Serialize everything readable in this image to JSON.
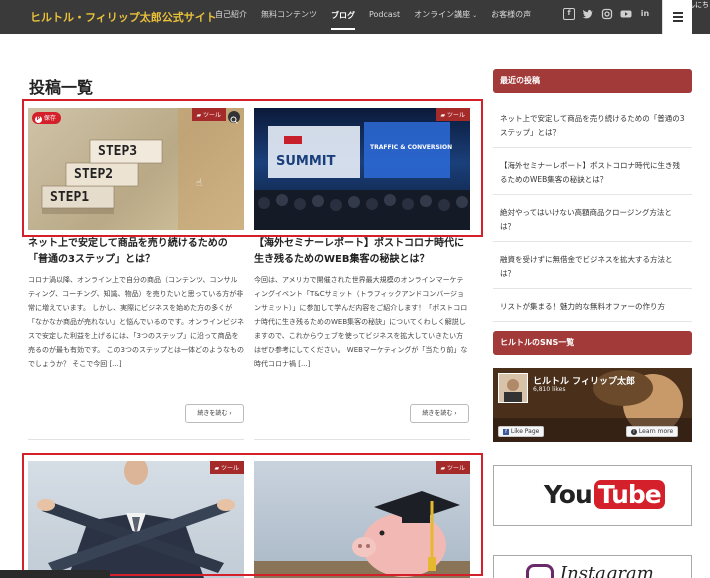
{
  "header": {
    "site_title": "ヒルトル・フィリップ太郎公式サイト",
    "nav": [
      {
        "label": "自己紹介"
      },
      {
        "label": "無料コンテンツ"
      },
      {
        "label": "ブログ"
      },
      {
        "label": "Podcast"
      },
      {
        "label": "オンライン講座"
      },
      {
        "label": "お客様の声"
      }
    ],
    "caret": "⌄",
    "social_icons": [
      "facebook-icon",
      "twitter-icon",
      "instagram-icon",
      "youtube-icon",
      "linkedin-icon"
    ],
    "menu_tip": "んにち"
  },
  "main": {
    "page_title": "投稿一覧",
    "posts": [
      {
        "category": "ツール",
        "save_label": "保存",
        "image_text": [
          "STEP3",
          "STEP2",
          "STEP1"
        ],
        "title": "ネット上で安定して商品を売り続けるための「普通の3ステップ」とは？",
        "excerpt": "コロナ渦以降、オンライン上で自分の商品（コンテンツ、コンサルティング、コーチング、知識、物品）を売りたいと思っている方が非常に増えています。 しかし、実際にビジネスを始めた方の多くが「なかなか商品が売れない」と悩んでいるのです。オンラインビジネスで安定した利益を上げるには、「3つのステップ」に沿って商品を売るのが最も有効です。 この3つのステップとは一体どのようなものでしょうか？ そこで今回 [...]",
        "more_label": "続きを読む"
      },
      {
        "category": "ツール",
        "image_text": [
          "SUMMIT",
          "TRAFFIC & CONVERSION"
        ],
        "title": "【海外セミナーレポート】ポストコロナ時代に生き残るためのWEB集客の秘訣とは？",
        "excerpt": "今回は、アメリカで開催された世界最大規模のオンラインマーケティングイベント「T&Cサミット（トラフィックアンドコンバージョンサミット）」に参加して学んだ内容をご紹介します！「ポストコロナ時代に生き残るためのWEB集客の秘訣」についてくわしく解説しますので、これからウェブを使ってビジネスを拡大していきたい方はぜひ参考にしてください。 WEBマーケティングが「当たり前」な時代コロナ禍 [...]",
        "more_label": "続きを読む"
      },
      {
        "category": "ツール"
      },
      {
        "category": "ツール"
      }
    ]
  },
  "sidebar": {
    "recent_title": "最近の投稿",
    "recent_posts": [
      "ネット上で安定して商品を売り続けるための「普通の3ステップ」とは？",
      "【海外セミナーレポート】ポストコロナ時代に生き残るためのWEB集客の秘訣とは？",
      "絶対やってはいけない高額商品クロージング方法とは？",
      "融資を受けずに無借金でビジネスを拡大する方法とは？",
      "リストが集まる！魅力的な無料オファーの作り方"
    ],
    "sns_title": "ヒルトルのSNS一覧",
    "fb_name": "ヒルトル フィリップ太郎",
    "fb_likes": "6,810 likes",
    "fb_like_label": "Like Page",
    "fb_learn_label": "Learn more",
    "youtube_label_a": "You",
    "youtube_label_b": "Tube",
    "instagram_label": "Instagram"
  },
  "colors": {
    "header_bg": "#3a3a3a",
    "site_title": "#e9c13a",
    "accent_red": "#a33a3a",
    "highlight_red": "#d4202a"
  }
}
